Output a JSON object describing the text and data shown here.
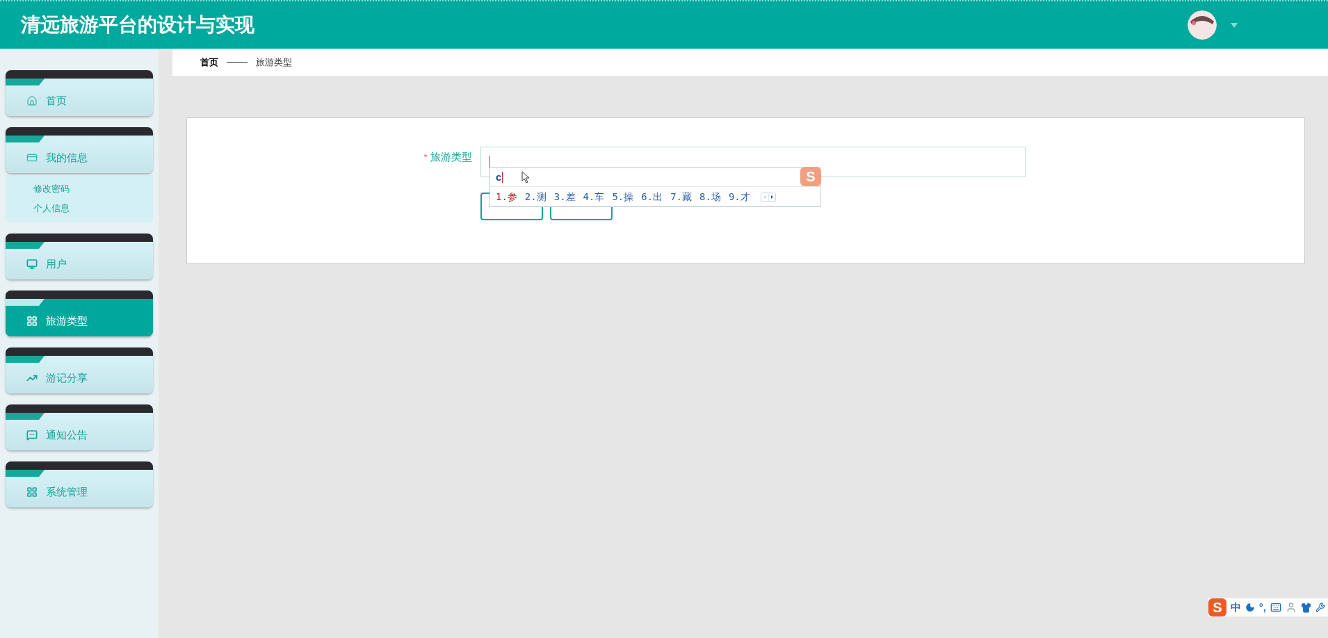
{
  "header": {
    "title": "清远旅游平台的设计与实现"
  },
  "sidebar": {
    "items": [
      {
        "label": "首页",
        "selected": false
      },
      {
        "label": "我的信息",
        "selected": false,
        "children": [
          {
            "label": "修改密码"
          },
          {
            "label": "个人信息"
          }
        ]
      },
      {
        "label": "用户",
        "selected": false
      },
      {
        "label": "旅游类型",
        "selected": true
      },
      {
        "label": "游记分享",
        "selected": false
      },
      {
        "label": "通知公告",
        "selected": false
      },
      {
        "label": "系统管理",
        "selected": false
      }
    ]
  },
  "breadcrumb": [
    "首页",
    "旅游类型"
  ],
  "form": {
    "label": "旅游类型",
    "required_mark": "*",
    "buttons": [
      {
        "kind": "outline"
      },
      {
        "kind": "outline"
      }
    ]
  },
  "ime_popup": {
    "composition": "c",
    "candidates": [
      {
        "text": "1.参",
        "selected": true
      },
      {
        "text": "2.测",
        "selected": false
      },
      {
        "text": "3.差",
        "selected": false
      },
      {
        "text": "4.车",
        "selected": false
      },
      {
        "text": "5.操",
        "selected": false
      },
      {
        "text": "6.出",
        "selected": false
      },
      {
        "text": "7.藏",
        "selected": false
      },
      {
        "text": "8.场",
        "selected": false
      },
      {
        "text": "9.才",
        "selected": false
      }
    ],
    "logo": "S"
  },
  "ime_bar": {
    "logo": "S",
    "mode": "中",
    "punct": "°,"
  }
}
